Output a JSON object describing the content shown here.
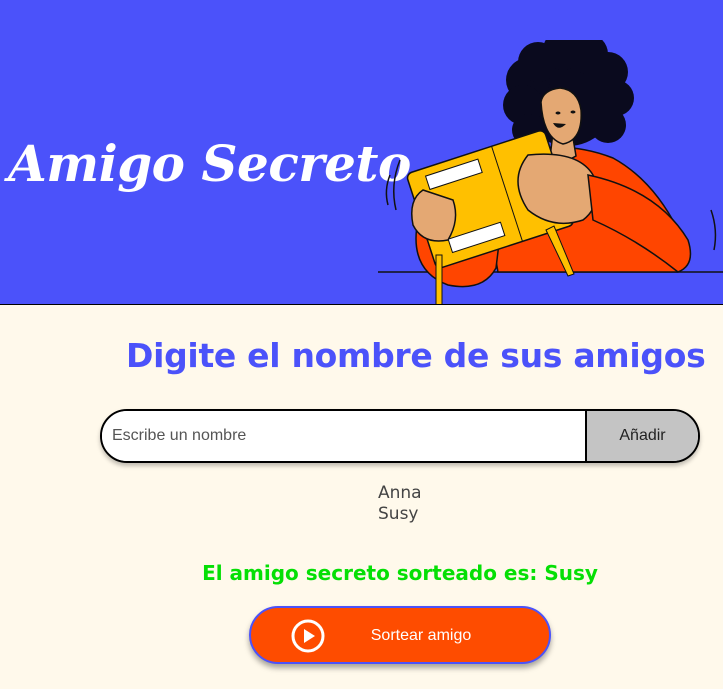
{
  "header": {
    "title": "Amigo Secreto",
    "illustration": "person-holding-gift-box",
    "bg_color": "#4B52FA"
  },
  "main": {
    "subtitle": "Digite el nombre de sus amigos",
    "input": {
      "placeholder": "Escribe un nombre",
      "value": ""
    },
    "add_button_label": "Añadir",
    "friends": [
      "Anna",
      "Susy"
    ],
    "result_text": "El amigo secreto sorteado es: Susy",
    "draw_button": {
      "label": "Sortear amigo",
      "icon": "play-circle-icon",
      "color": "#FE4C00"
    }
  },
  "colors": {
    "accent": "#4B52FA",
    "background": "#FFF9EB",
    "result": "#05DF05",
    "button": "#FE4C00"
  }
}
